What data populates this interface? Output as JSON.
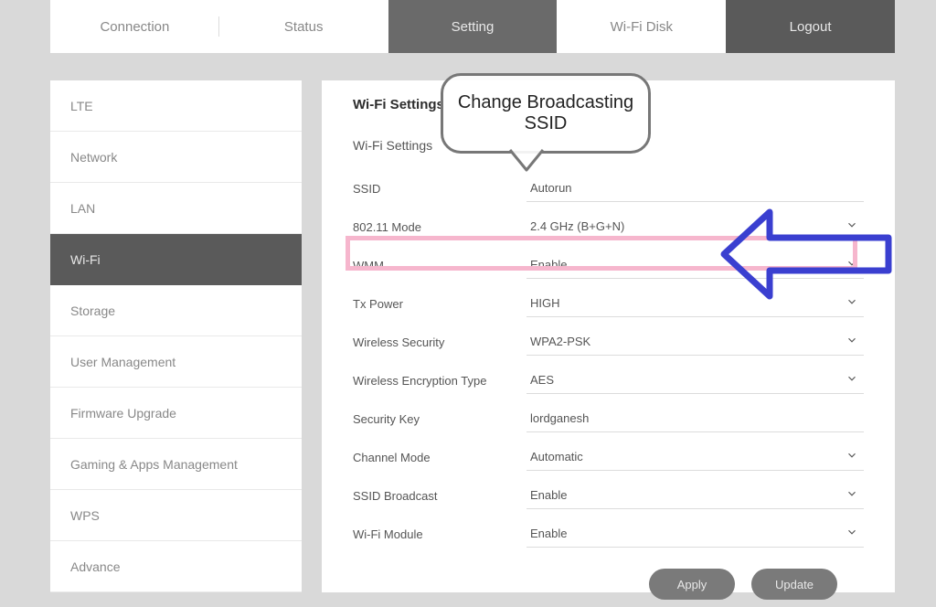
{
  "topnav": {
    "tabs": [
      {
        "label": "Connection"
      },
      {
        "label": "Status"
      },
      {
        "label": "Setting"
      },
      {
        "label": "Wi-Fi Disk"
      },
      {
        "label": "Logout"
      }
    ],
    "active_index": 2
  },
  "sidebar": {
    "items": [
      {
        "label": "LTE"
      },
      {
        "label": "Network"
      },
      {
        "label": "LAN"
      },
      {
        "label": "Wi-Fi"
      },
      {
        "label": "Storage"
      },
      {
        "label": "User Management"
      },
      {
        "label": "Firmware Upgrade"
      },
      {
        "label": "Gaming & Apps Management"
      },
      {
        "label": "WPS"
      },
      {
        "label": "Advance"
      }
    ],
    "active_index": 3
  },
  "main": {
    "heading": "Wi-Fi Settings",
    "subheading": "Wi-Fi Settings",
    "rows": [
      {
        "label": "SSID",
        "value": "Autorun",
        "dropdown": false
      },
      {
        "label": "802.11 Mode",
        "value": "2.4 GHz (B+G+N)",
        "dropdown": true
      },
      {
        "label": "WMM",
        "value": "Enable",
        "dropdown": true
      },
      {
        "label": "Tx Power",
        "value": "HIGH",
        "dropdown": true
      },
      {
        "label": "Wireless Security",
        "value": "WPA2-PSK",
        "dropdown": true
      },
      {
        "label": "Wireless Encryption Type",
        "value": "AES",
        "dropdown": true
      },
      {
        "label": "Security Key",
        "value": "lordganesh",
        "dropdown": false
      },
      {
        "label": "Channel Mode",
        "value": "Automatic",
        "dropdown": true
      },
      {
        "label": "SSID Broadcast",
        "value": "Enable",
        "dropdown": true
      },
      {
        "label": "Wi-Fi Module",
        "value": "Enable",
        "dropdown": true
      }
    ],
    "buttons": {
      "apply": "Apply",
      "update": "Update"
    }
  },
  "annotation": {
    "callout_line1": "Change Broadcasting",
    "callout_line2": "SSID"
  }
}
